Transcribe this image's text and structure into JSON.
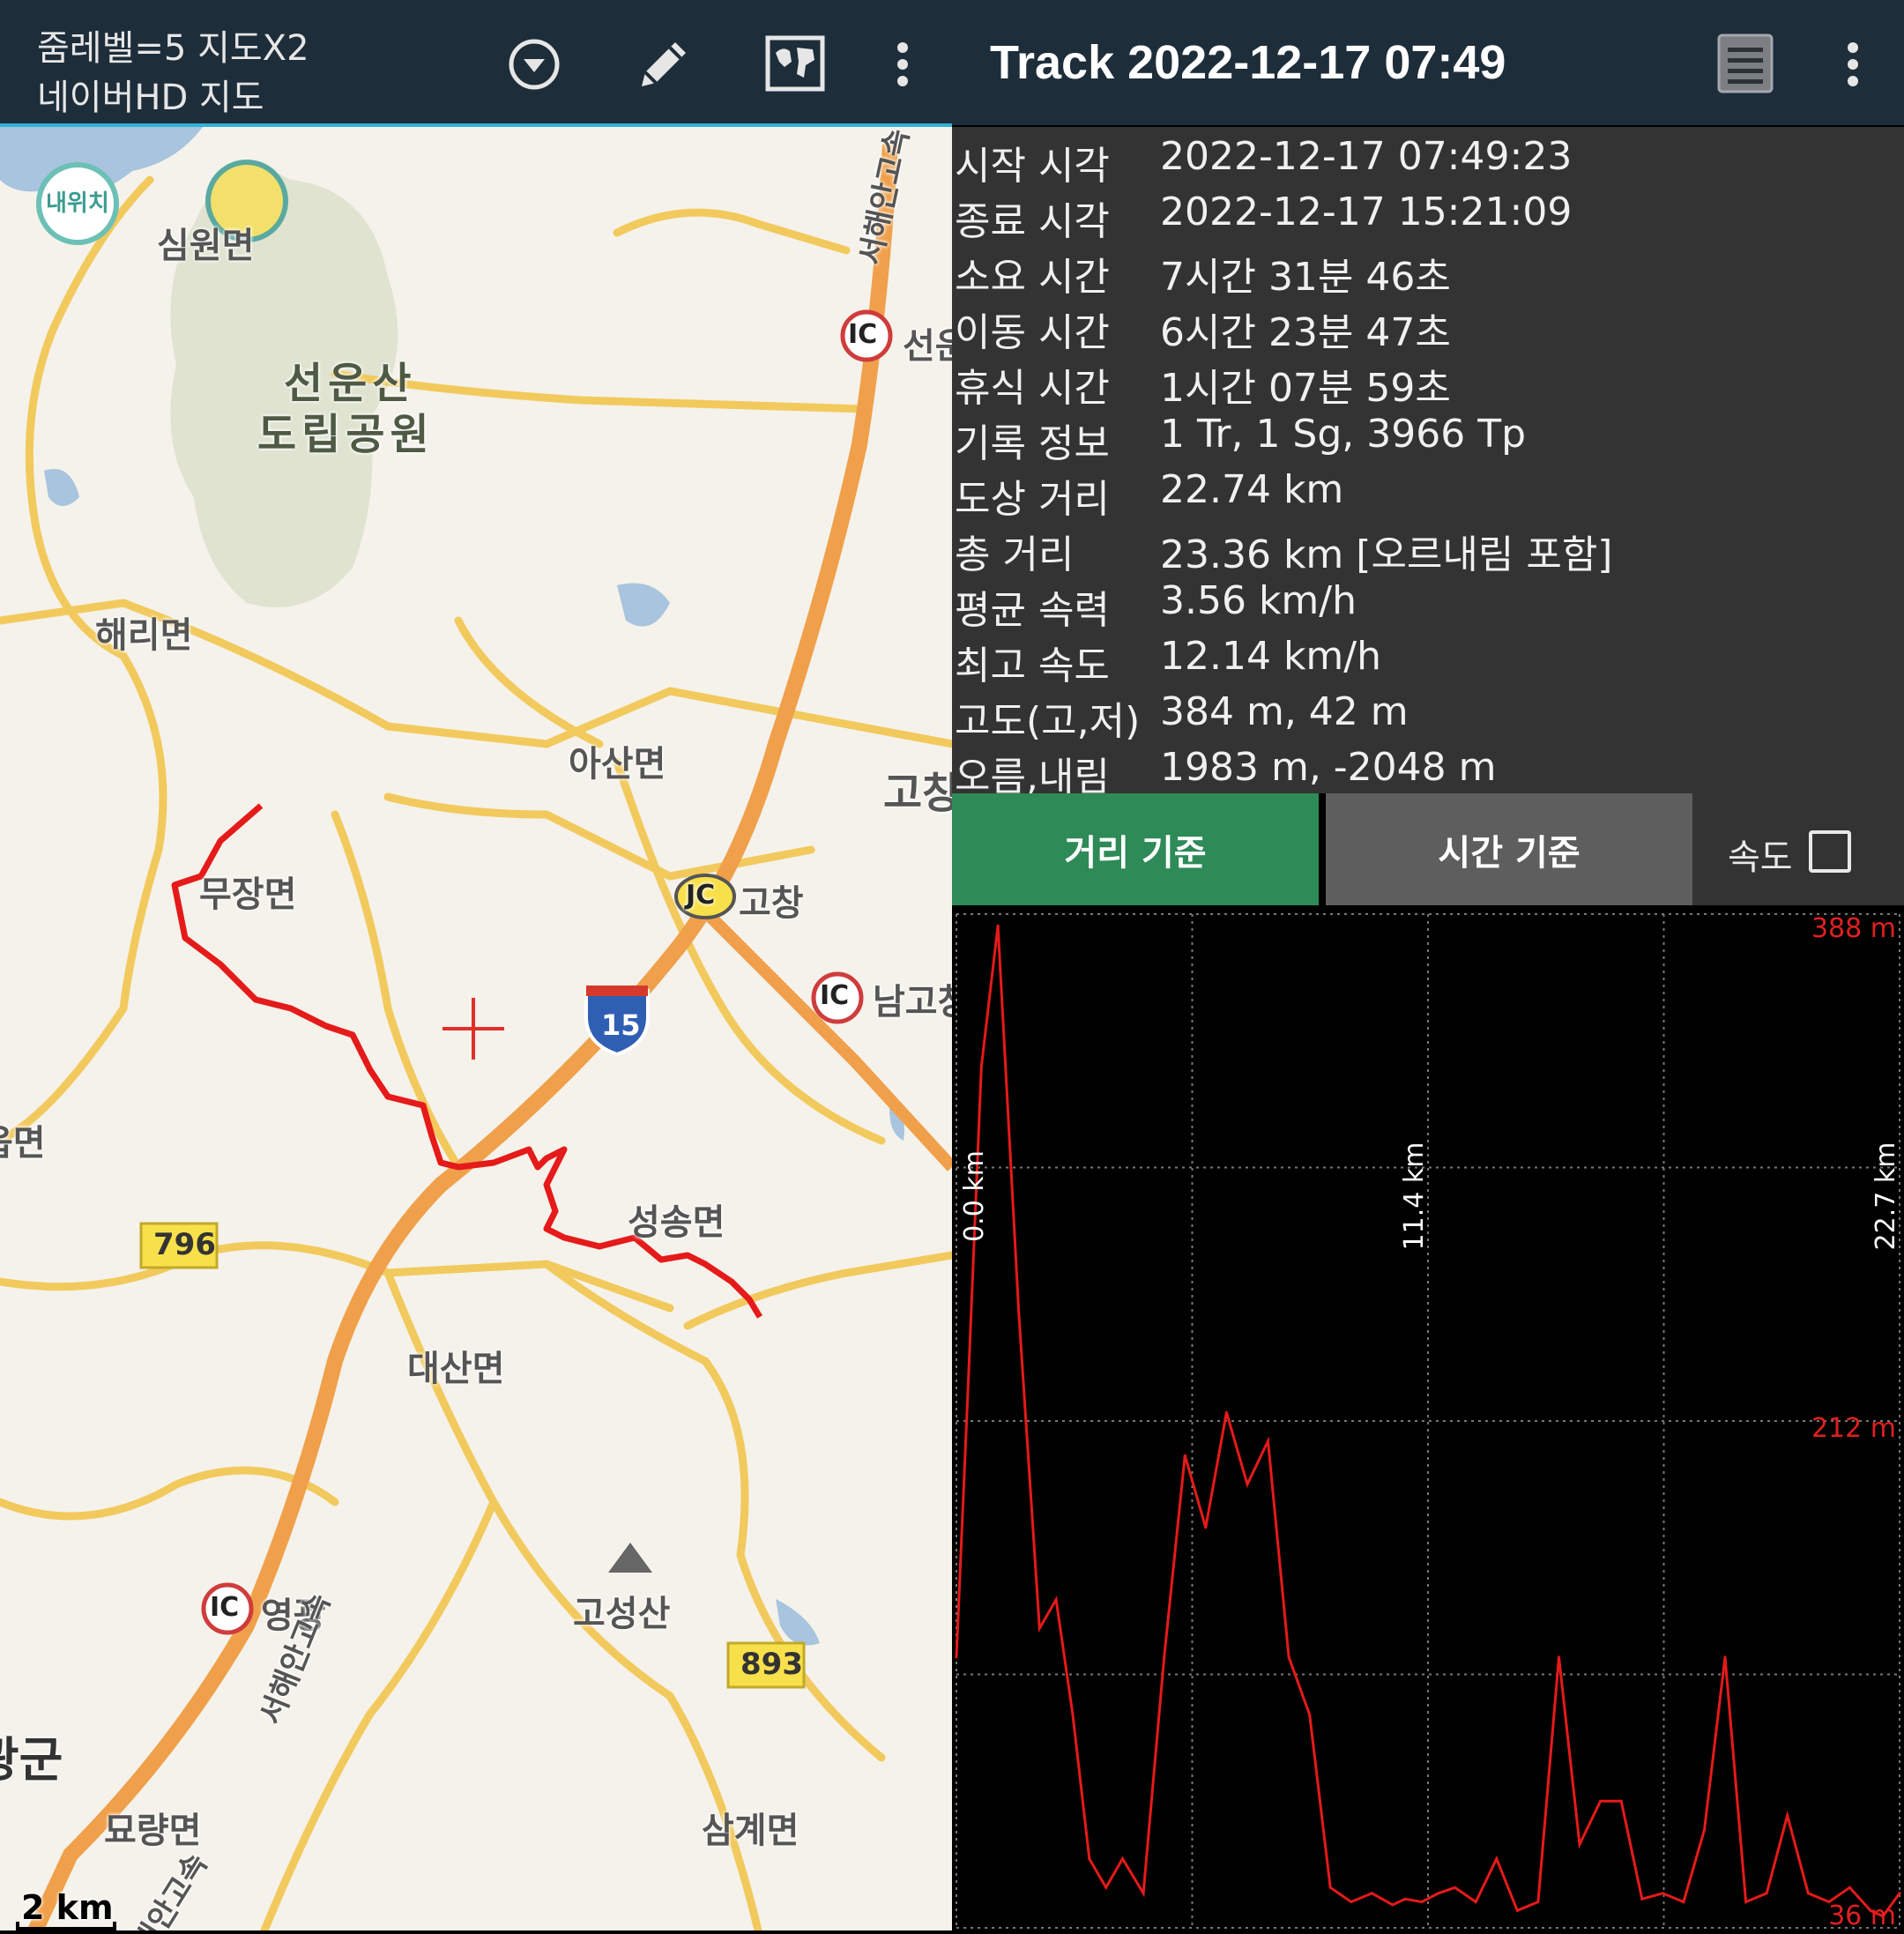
{
  "header": {
    "zoom_text": "줌레벨=5 지도X2",
    "map_name": "네이버HD 지도",
    "track_title": "Track 2022-12-17 07:49"
  },
  "map": {
    "labels": {
      "my_location": "내위치",
      "simwon": "심원면",
      "park_line1": "선운산",
      "park_line2": "도립공원",
      "haeri": "해리면",
      "asan": "아산면",
      "mujang": "무장면",
      "gochang": "고창",
      "gochang_partial": "고창",
      "namgochang": "남고창",
      "seongsong": "성송면",
      "daesan": "대산면",
      "gosungsan": "고성산",
      "yeonggwang": "영광",
      "myoryang": "묘량면",
      "samgye": "삼계면",
      "gun": "광군",
      "eup": "읍면",
      "seonun_ic": "선운",
      "expressway_top": "서해안고속",
      "expressway_mid": "서해안고속",
      "expressway_bottom": "서해안고속"
    },
    "markers": {
      "ic": "IC",
      "jc": "JC",
      "route_15": "15",
      "route_796": "796",
      "route_893": "893"
    },
    "scale": "2 km"
  },
  "stats": [
    {
      "key": "시작 시각",
      "value": "2022-12-17 07:49:23"
    },
    {
      "key": "종료 시각",
      "value": "2022-12-17 15:21:09"
    },
    {
      "key": "소요 시간",
      "value": "7시간 31분 46초"
    },
    {
      "key": "이동 시간",
      "value": "6시간 23분 47초"
    },
    {
      "key": "휴식 시간",
      "value": "1시간 07분 59초"
    },
    {
      "key": "기록 정보",
      "value": "1 Tr, 1 Sg, 3966 Tp"
    },
    {
      "key": "도상 거리",
      "value": "22.74 km"
    },
    {
      "key": "총 거리",
      "value": "23.36 km [오르내림 포함]"
    },
    {
      "key": "평균 속력",
      "value": "3.56 km/h"
    },
    {
      "key": "최고 속도",
      "value": "12.14 km/h"
    },
    {
      "key": "고도(고,저)",
      "value": "384 m, 42 m"
    },
    {
      "key": "오름,내림",
      "value": "1983 m, -2048 m"
    }
  ],
  "tabs": {
    "distance": "거리 기준",
    "time": "시간 기준",
    "speed": "속도"
  },
  "colors": {
    "active_tab": "#2e8a57",
    "inactive_tab": "#5e5e5e",
    "track": "#e51a1a",
    "topbar": "#1e2d3a"
  },
  "chart_data": {
    "type": "line",
    "title": "",
    "x_axis_labels": [
      "0.0 km",
      "11.4 km",
      "22.7 km"
    ],
    "y_axis_labels": [
      "388 m",
      "212 m",
      "36 m"
    ],
    "xlim": [
      0,
      22.7
    ],
    "ylim": [
      36,
      388
    ],
    "grid": true,
    "series": [
      {
        "x": [
          0.0,
          0.3,
          0.6,
          1.0,
          1.5,
          2.0,
          2.4,
          2.8,
          3.2,
          3.6,
          4.0,
          4.5,
          5.0,
          5.5,
          6.0,
          6.5,
          7.0,
          7.5,
          8.0,
          8.5,
          9.0,
          9.5,
          10.0,
          10.5,
          10.8,
          11.2,
          11.6,
          12.0,
          12.5,
          13.0,
          13.5,
          14.0,
          14.5,
          15.0,
          15.5,
          16.0,
          16.5,
          17.0,
          17.5,
          18.0,
          18.5,
          19.0,
          19.5,
          20.0,
          20.5,
          21.0,
          21.5,
          22.0,
          22.3,
          22.7
        ],
        "values": [
          130,
          230,
          335,
          384,
          250,
          140,
          150,
          110,
          60,
          50,
          60,
          48,
          130,
          200,
          175,
          215,
          190,
          205,
          130,
          110,
          50,
          45,
          48,
          44,
          46,
          45,
          48,
          50,
          45,
          60,
          42,
          45,
          130,
          65,
          80,
          80,
          46,
          48,
          45,
          70,
          130,
          45,
          48,
          75,
          48,
          45,
          50,
          42,
          40,
          48
        ]
      }
    ]
  }
}
